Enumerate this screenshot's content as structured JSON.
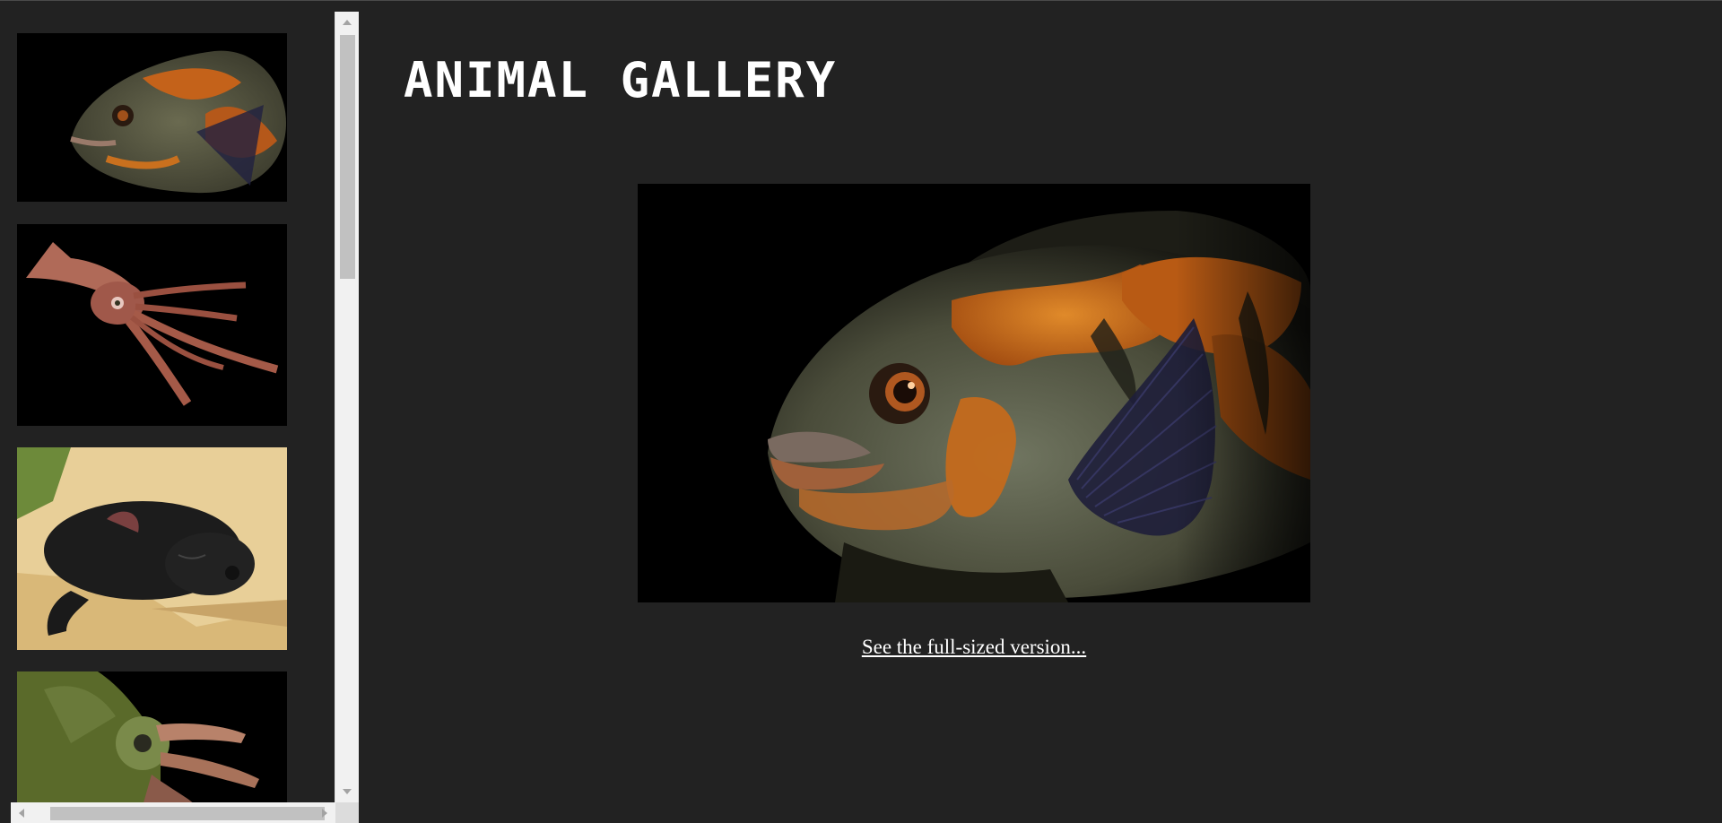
{
  "header": {
    "title": "ANIMAL GALLERY"
  },
  "main": {
    "image_icon": "oscar-fish-photo",
    "full_size_link": "See the full-sized version..."
  },
  "sidebar": {
    "thumbnails": [
      {
        "icon": "oscar-fish-thumbnail"
      },
      {
        "icon": "squid-thumbnail"
      },
      {
        "icon": "tasmanian-devil-thumbnail"
      },
      {
        "icon": "chameleon-thumbnail"
      }
    ]
  },
  "colors": {
    "background": "#222222",
    "text": "#ffffff",
    "scrollbar_track": "#f1f1f1",
    "scrollbar_thumb": "#c1c1c1"
  }
}
